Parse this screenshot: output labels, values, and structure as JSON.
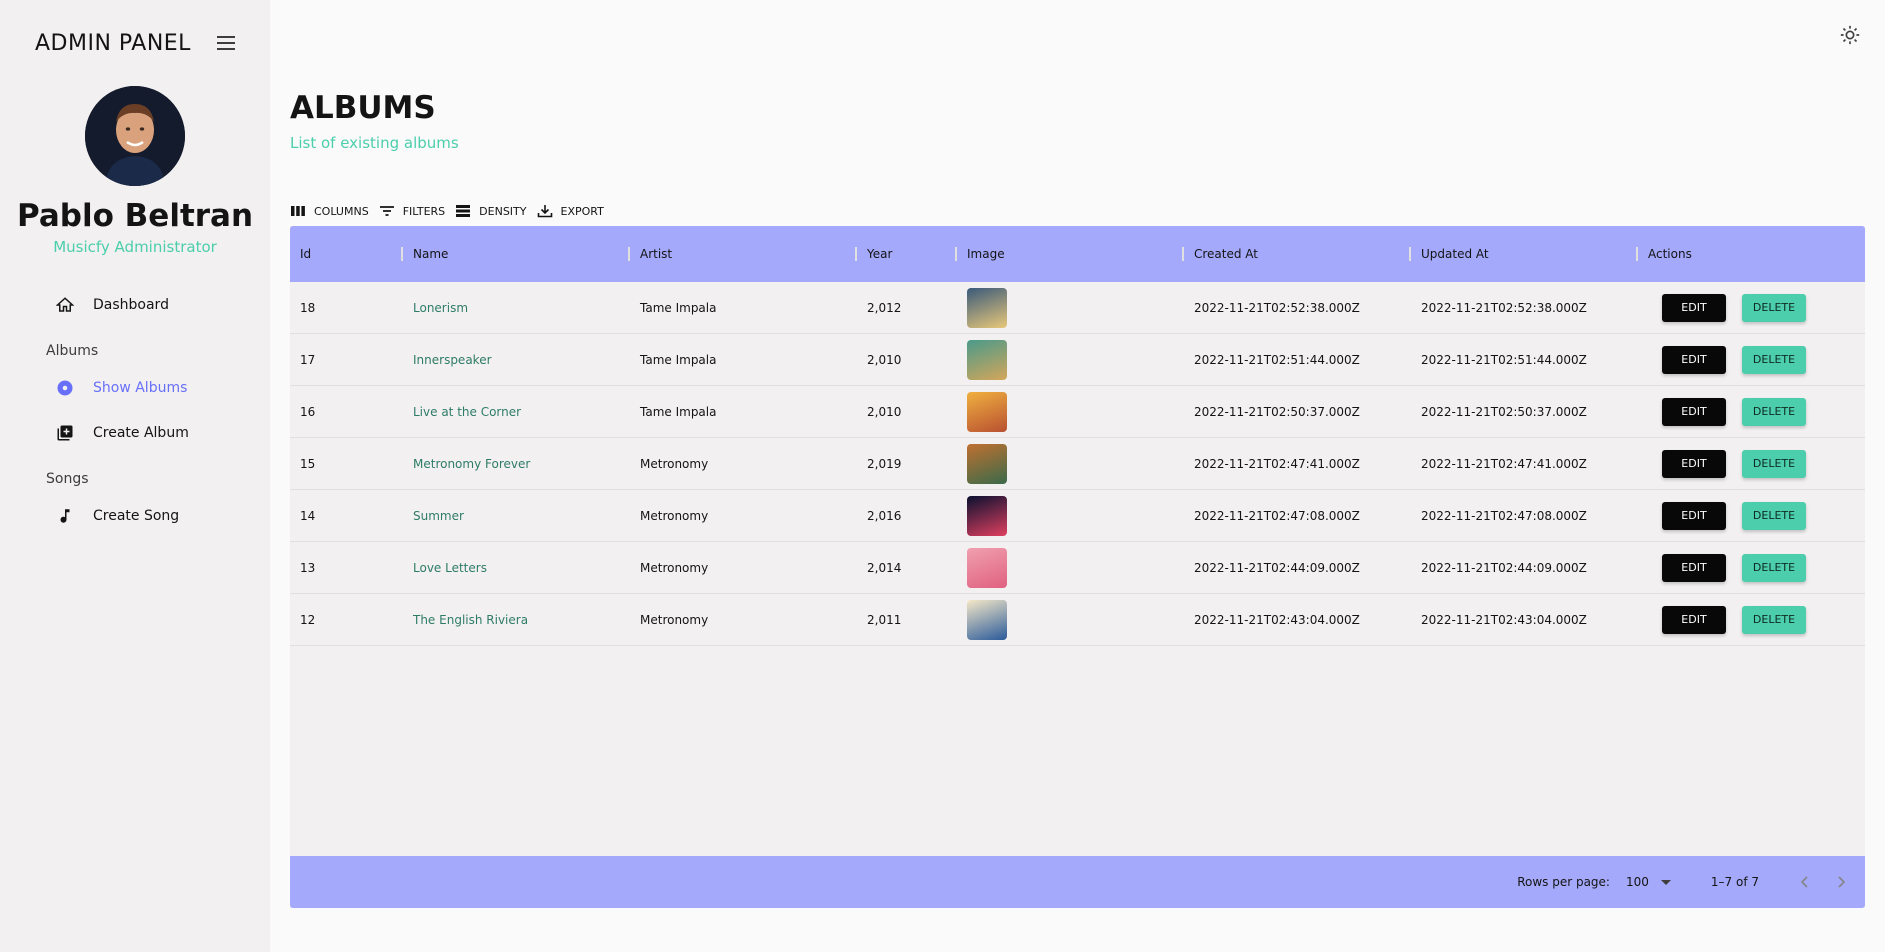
{
  "sidebar": {
    "title": "ADMIN PANEL",
    "user": {
      "name": "Pablo Beltran",
      "role": "Musicfy Administrator"
    },
    "nav": {
      "dashboard": "Dashboard",
      "albums_section": "Albums",
      "show_albums": "Show Albums",
      "create_album": "Create Album",
      "songs_section": "Songs",
      "create_song": "Create Song"
    }
  },
  "header": {
    "title": "ALBUMS",
    "subtitle": "List of existing albums"
  },
  "toolbar": {
    "columns": "COLUMNS",
    "filters": "FILTERS",
    "density": "DENSITY",
    "export": "EXPORT"
  },
  "table": {
    "columns": [
      "Id",
      "Name",
      "Artist",
      "Year",
      "Image",
      "Created At",
      "Updated At",
      "Actions"
    ],
    "rows": [
      {
        "id": "18",
        "name": "Lonerism",
        "artist": "Tame Impala",
        "year": "2,012",
        "created": "2022-11-21T02:52:38.000Z",
        "updated": "2022-11-21T02:52:38.000Z",
        "colors": [
          "#3a5a7a",
          "#e8c87a"
        ]
      },
      {
        "id": "17",
        "name": "Innerspeaker",
        "artist": "Tame Impala",
        "year": "2,010",
        "created": "2022-11-21T02:51:44.000Z",
        "updated": "2022-11-21T02:51:44.000Z",
        "colors": [
          "#4a9a8a",
          "#d4a65a"
        ]
      },
      {
        "id": "16",
        "name": "Live at the Corner",
        "artist": "Tame Impala",
        "year": "2,010",
        "created": "2022-11-21T02:50:37.000Z",
        "updated": "2022-11-21T02:50:37.000Z",
        "colors": [
          "#f0b040",
          "#b85030"
        ]
      },
      {
        "id": "15",
        "name": "Metronomy Forever",
        "artist": "Metronomy",
        "year": "2,019",
        "created": "2022-11-21T02:47:41.000Z",
        "updated": "2022-11-21T02:47:41.000Z",
        "colors": [
          "#c07030",
          "#3a6a4a"
        ]
      },
      {
        "id": "14",
        "name": "Summer",
        "artist": "Metronomy",
        "year": "2,016",
        "created": "2022-11-21T02:47:08.000Z",
        "updated": "2022-11-21T02:47:08.000Z",
        "colors": [
          "#0a1030",
          "#e04060"
        ]
      },
      {
        "id": "13",
        "name": "Love Letters",
        "artist": "Metronomy",
        "year": "2,014",
        "created": "2022-11-21T02:44:09.000Z",
        "updated": "2022-11-21T02:44:09.000Z",
        "colors": [
          "#f0a0b0",
          "#e06080"
        ]
      },
      {
        "id": "12",
        "name": "The English Riviera",
        "artist": "Metronomy",
        "year": "2,011",
        "created": "2022-11-21T02:43:04.000Z",
        "updated": "2022-11-21T02:43:04.000Z",
        "colors": [
          "#f5e8c8",
          "#2a5a9a"
        ]
      }
    ],
    "edit_label": "EDIT",
    "delete_label": "DELETE"
  },
  "footer": {
    "rows_per_page_label": "Rows per page:",
    "rows_per_page_value": "100",
    "range": "1–7 of 7"
  },
  "colors": {
    "accent": "#6870fa",
    "header_bg": "#a4a9fc",
    "green": "#4cceac",
    "link": "#2e7c67"
  }
}
